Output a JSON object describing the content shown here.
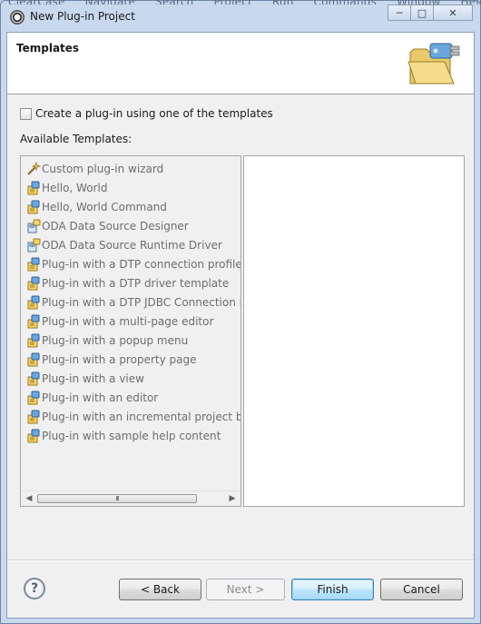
{
  "menu_bleed": [
    "ClearCase",
    "Navigate",
    "Search",
    "Project",
    "Run",
    "Commands",
    "Window",
    "Help"
  ],
  "window": {
    "title": "New Plug-in Project",
    "icon": "eclipse-icon",
    "controls": {
      "minimize": "─",
      "maximize": "□",
      "close": "✕"
    }
  },
  "header": {
    "title": "Templates",
    "graphic": "plugin-folder-icon"
  },
  "checkbox": {
    "label": "Create a plug-in using one of the templates",
    "checked": false
  },
  "available_label": "Available Templates:",
  "templates": [
    {
      "label": "Custom plug-in wizard",
      "icon": "wizard-wand-icon"
    },
    {
      "label": "Hello, World",
      "icon": "plugin-template-icon"
    },
    {
      "label": "Hello, World Command",
      "icon": "plugin-template-icon"
    },
    {
      "label": "ODA Data Source Designer",
      "icon": "oda-template-icon"
    },
    {
      "label": "ODA Data Source Runtime Driver",
      "icon": "oda-template-icon"
    },
    {
      "label": "Plug-in with a DTP connection profile",
      "icon": "plugin-template-icon"
    },
    {
      "label": "Plug-in with a DTP driver template",
      "icon": "plugin-template-icon"
    },
    {
      "label": "Plug-in with a DTP JDBC Connection P",
      "icon": "plugin-template-icon"
    },
    {
      "label": "Plug-in with a multi-page editor",
      "icon": "plugin-template-icon"
    },
    {
      "label": "Plug-in with a popup menu",
      "icon": "plugin-template-icon"
    },
    {
      "label": "Plug-in with a property page",
      "icon": "plugin-template-icon"
    },
    {
      "label": "Plug-in with a view",
      "icon": "plugin-template-icon"
    },
    {
      "label": "Plug-in with an editor",
      "icon": "plugin-template-icon"
    },
    {
      "label": "Plug-in with an incremental project bu",
      "icon": "plugin-template-icon"
    },
    {
      "label": "Plug-in with sample help content",
      "icon": "plugin-template-icon"
    }
  ],
  "scrollbar": {
    "left": "◀",
    "right": "▶",
    "grip": "III"
  },
  "footer": {
    "help": "?",
    "back": "< Back",
    "next": "Next >",
    "finish": "Finish",
    "cancel": "Cancel"
  },
  "colors": {
    "window_frame": "#c8d9ee",
    "dialog_bg": "#f0f0f0",
    "disabled_text": "#6d6d6d",
    "default_button": "#3c7fb1"
  }
}
